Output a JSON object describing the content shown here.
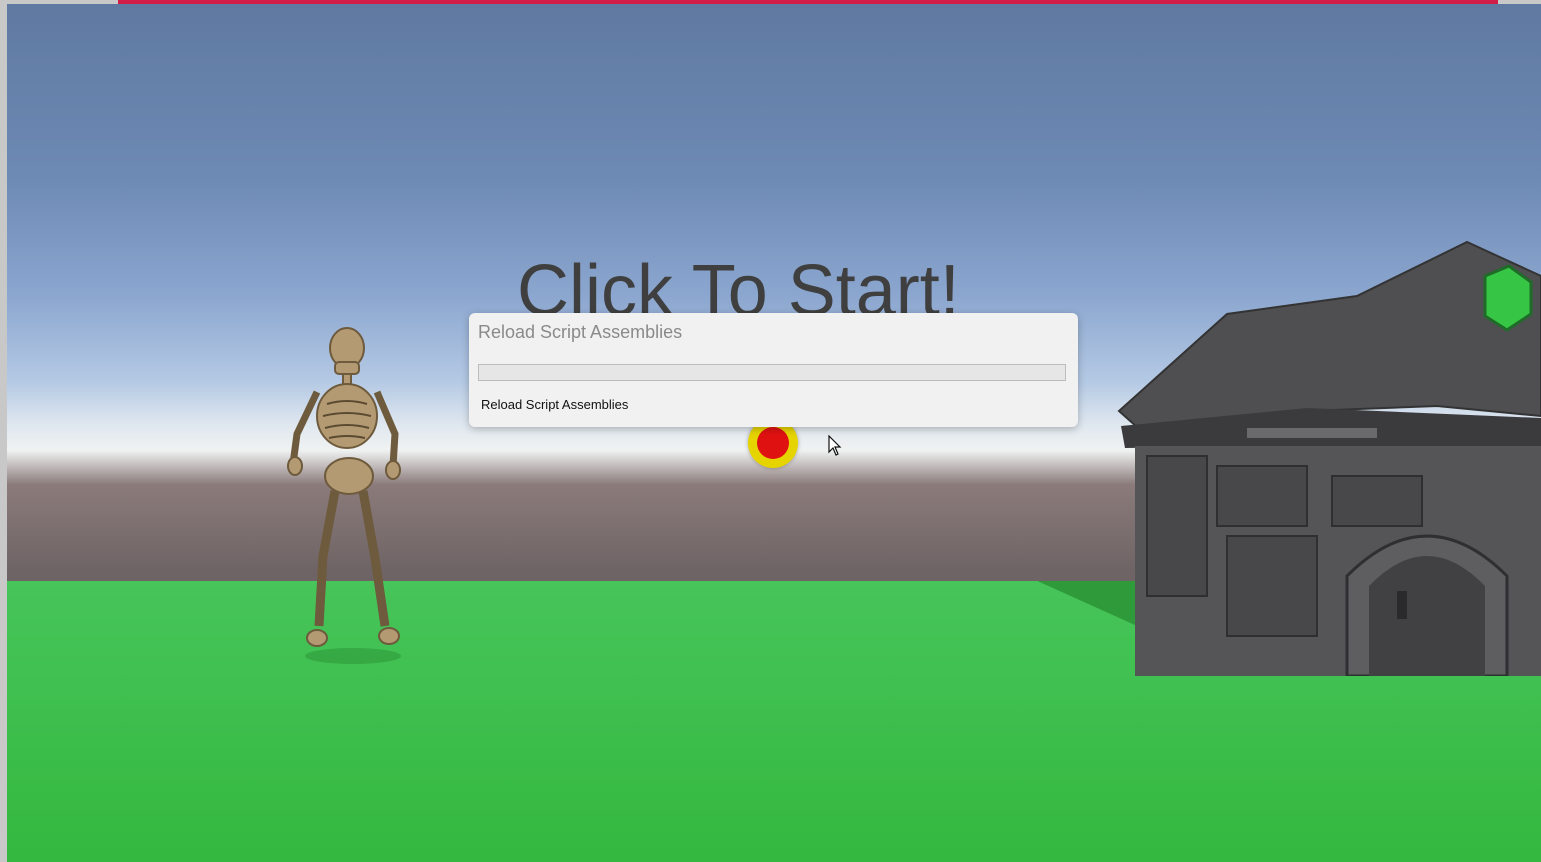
{
  "game": {
    "start_prompt": "Click To Start!"
  },
  "dialog": {
    "title": "Reload Script Assemblies",
    "progress": 0,
    "status": "Reload Script Assemblies"
  },
  "colors": {
    "accent_bar": "#d01e48",
    "ground": "#3fc04f",
    "record_ring": "#e6d400",
    "record_dot": "#e01111"
  },
  "icons": {
    "cursor": "mouse-pointer-icon",
    "record": "record-icon"
  }
}
